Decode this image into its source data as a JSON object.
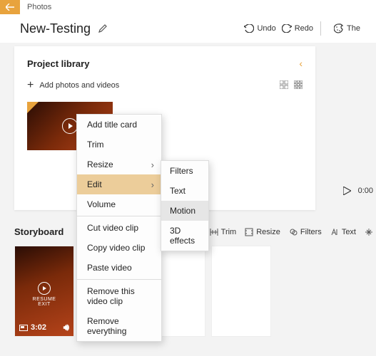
{
  "app": {
    "name": "Photos"
  },
  "header": {
    "title": "New-Testing",
    "undo": "Undo",
    "redo": "Redo",
    "theme": "The"
  },
  "library": {
    "title": "Project library",
    "add": "Add photos and videos"
  },
  "playback": {
    "time": "0:00"
  },
  "storyboard": {
    "title": "Storyboard",
    "tools": {
      "trim": "Trim",
      "resize": "Resize",
      "filters": "Filters",
      "text": "Text"
    },
    "clip": {
      "resume": "RESUME",
      "exit": "EXIT",
      "duration": "3:02"
    }
  },
  "ctx_main": {
    "add_title": "Add title card",
    "trim": "Trim",
    "resize": "Resize",
    "edit": "Edit",
    "volume": "Volume",
    "cut": "Cut video clip",
    "copy": "Copy video clip",
    "paste": "Paste video",
    "remove_clip": "Remove this video clip",
    "remove_all": "Remove everything"
  },
  "ctx_edit": {
    "filters": "Filters",
    "text": "Text",
    "motion": "Motion",
    "effects": "3D effects"
  }
}
